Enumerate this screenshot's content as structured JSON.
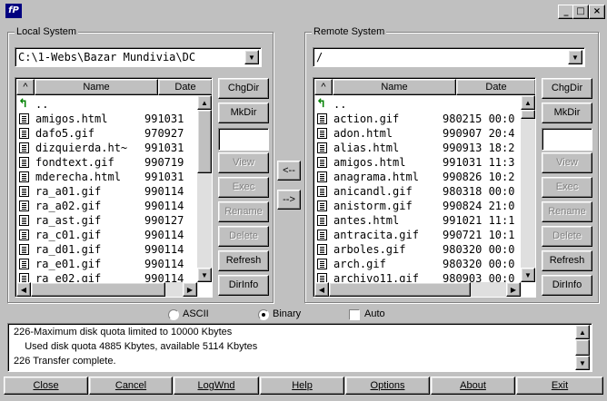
{
  "title": {
    "icon_text": "fP"
  },
  "local": {
    "label": "Local System",
    "path": "C:\\1-Webs\\Bazar Mundivia\\DC",
    "col_name": "Name",
    "col_date": "Date",
    "sort_glyph": "^",
    "parent": "..",
    "files": [
      {
        "name": "amigos.html",
        "date": "991031"
      },
      {
        "name": "dafo5.gif",
        "date": "970927"
      },
      {
        "name": "dizquierda.ht~",
        "date": "991031"
      },
      {
        "name": "fondtext.gif",
        "date": "990719"
      },
      {
        "name": "mderecha.html",
        "date": "991031"
      },
      {
        "name": "ra_a01.gif",
        "date": "990114"
      },
      {
        "name": "ra_a02.gif",
        "date": "990114"
      },
      {
        "name": "ra_ast.gif",
        "date": "990127"
      },
      {
        "name": "ra_c01.gif",
        "date": "990114"
      },
      {
        "name": "ra_d01.gif",
        "date": "990114"
      },
      {
        "name": "ra_e01.gif",
        "date": "990114"
      },
      {
        "name": "ra_e02.gif",
        "date": "990114"
      }
    ],
    "buttons": [
      "ChgDir",
      "MkDir",
      "View",
      "Exec",
      "Rename",
      "Delete",
      "Refresh",
      "DirInfo"
    ]
  },
  "remote": {
    "label": "Remote System",
    "path": "/",
    "col_name": "Name",
    "col_date": "Date",
    "sort_glyph": "^",
    "parent": "..",
    "files": [
      {
        "name": "action.gif",
        "date": "980215 00:0"
      },
      {
        "name": "adon.html",
        "date": "990907 20:4"
      },
      {
        "name": "alias.html",
        "date": "990913 18:2"
      },
      {
        "name": "amigos.html",
        "date": "991031 11:3"
      },
      {
        "name": "anagrama.html",
        "date": "990826 10:2"
      },
      {
        "name": "anicandl.gif",
        "date": "980318 00:0"
      },
      {
        "name": "anistorm.gif",
        "date": "990824 21:0"
      },
      {
        "name": "antes.html",
        "date": "991021 11:1"
      },
      {
        "name": "antracita.gif",
        "date": "990721 10:1"
      },
      {
        "name": "arboles.gif",
        "date": "980320 00:0"
      },
      {
        "name": "arch.gif",
        "date": "980320 00:0"
      },
      {
        "name": "archivo11.gif",
        "date": "980903 00:0"
      }
    ],
    "buttons": [
      "ChgDir",
      "MkDir",
      "View",
      "Exec",
      "Rename",
      "Delete",
      "Refresh",
      "DirInfo"
    ]
  },
  "transfer": {
    "download": "<--",
    "upload": "-->"
  },
  "mode": {
    "ascii": "ASCII",
    "binary": "Binary",
    "auto": "Auto"
  },
  "log": [
    "226-Maximum disk quota limited to 10000 Kbytes",
    "    Used disk quota 4885 Kbytes, available 5114 Kbytes",
    "226 Transfer complete."
  ],
  "bottom": [
    "Close",
    "Cancel",
    "LogWnd",
    "Help",
    "Options",
    "About",
    "Exit"
  ],
  "window_buttons": {
    "minimize": "_",
    "maximize": "□",
    "close": "×"
  }
}
